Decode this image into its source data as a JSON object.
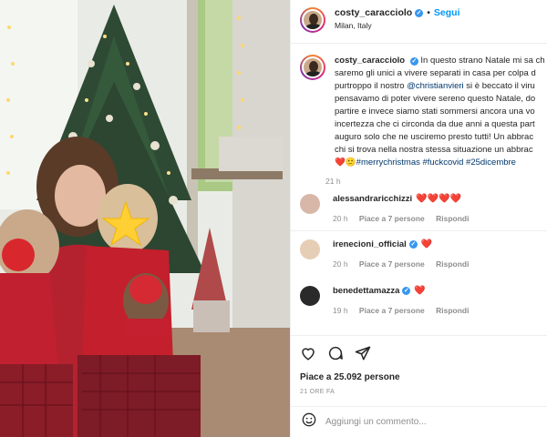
{
  "post": {
    "username": "costy_caracciolo",
    "follow_label": "Segui",
    "location": "Milan, Italy",
    "caption_lines": [
      "In questo strano Natale mi sa ch",
      "saremo gli unici a vivere separati in casa per colpa d",
      "purtroppo il nostro ",
      "pensavamo di poter vivere sereno questo Natale, do",
      "partire e invece siamo stati sommersi ancora una vo",
      "incertezza che ci circonda da due anni a questa part",
      "auguro solo che ne usciremo presto tutti! Un abbrac",
      "chi si trova nella nostra stessa situazione un abbrac"
    ],
    "mention": "@christianvieri",
    "caption_line3_rest": " si è beccato il viru",
    "caption_emoji": "❤️🙂",
    "hashtags": "#merrychristmas #fuckcovid #25dicembre",
    "caption_time": "21 h"
  },
  "comments": [
    {
      "username": "alessandraricchizzi",
      "text": "❤️❤️❤️❤️",
      "time": "20 h",
      "likes": "Piace a 7 persone",
      "reply": "Rispondi",
      "avatar_color": "#d8b7a8"
    },
    {
      "username": "irenecioni_official",
      "text": "❤️",
      "time": "20 h",
      "likes": "Piace a 7 persone",
      "reply": "Rispondi",
      "avatar_color": "#e6cdb5"
    },
    {
      "username": "benedettamazza",
      "text": "❤️",
      "time": "19 h",
      "likes": "Piace a 7 persone",
      "reply": "Rispondi",
      "avatar_color": "#2a2a2a"
    }
  ],
  "actions": {
    "like_icon": "heart-icon",
    "comment_icon": "comment-icon",
    "share_icon": "share-icon",
    "likes_text": "Piace a 25.092 persone",
    "time_ago": "21 ORE FA"
  },
  "add_comment": {
    "emoji_icon": "emoji-icon",
    "placeholder": "Aggiungi un commento..."
  },
  "colors": {
    "link": "#00376b",
    "follow": "#0095f6",
    "verified": "#3897f0",
    "heart": "#e0245e"
  }
}
